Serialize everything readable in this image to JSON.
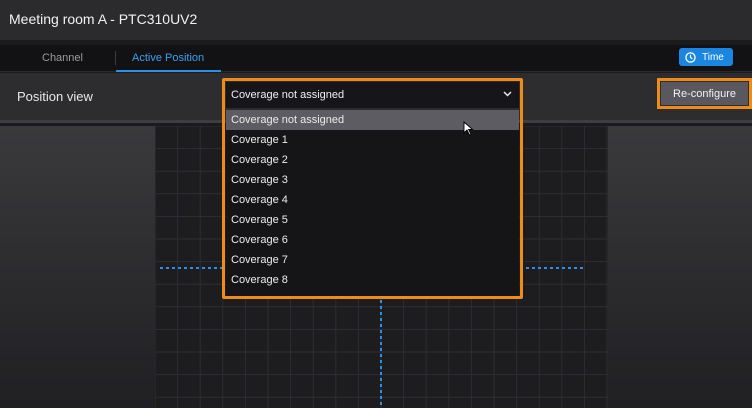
{
  "window": {
    "title": "Meeting room A - PTC310UV2"
  },
  "tabs": [
    {
      "label": "Channel",
      "active": false
    },
    {
      "label": "Active Position",
      "active": true
    }
  ],
  "time_button": {
    "label": "Time",
    "icon": "clock-icon",
    "color": "#1b86e0"
  },
  "position": {
    "label": "Position view",
    "select": {
      "value": "Coverage not assigned",
      "options": [
        "Coverage not assigned",
        "Coverage 1",
        "Coverage 2",
        "Coverage 3",
        "Coverage 4",
        "Coverage 5",
        "Coverage 6",
        "Coverage 7",
        "Coverage 8"
      ],
      "highlighted_option": "Coverage not assigned"
    },
    "reconfigure_label": "Re-configure"
  },
  "colors": {
    "accent": "#2e8fe6",
    "highlight": "#ee8c1a",
    "background": "#1b1b1d"
  }
}
